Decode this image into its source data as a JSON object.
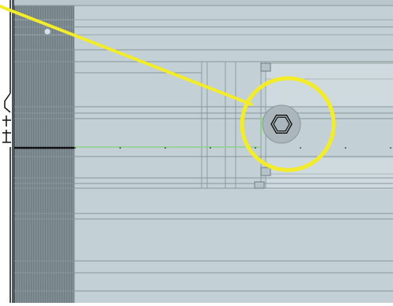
{
  "viewport": {
    "title": "",
    "annotation": {
      "shape": "circle",
      "stroke_color": "#f2ec2a",
      "target": "hex-nut"
    },
    "colors": {
      "panel_dark": "#7d8b90",
      "panel_main": "#c2cfd4",
      "panel_light": "#cfdade",
      "guide_line": "#8fd18a",
      "outline": "#111111",
      "nut_fill": "#aab6bb"
    }
  }
}
